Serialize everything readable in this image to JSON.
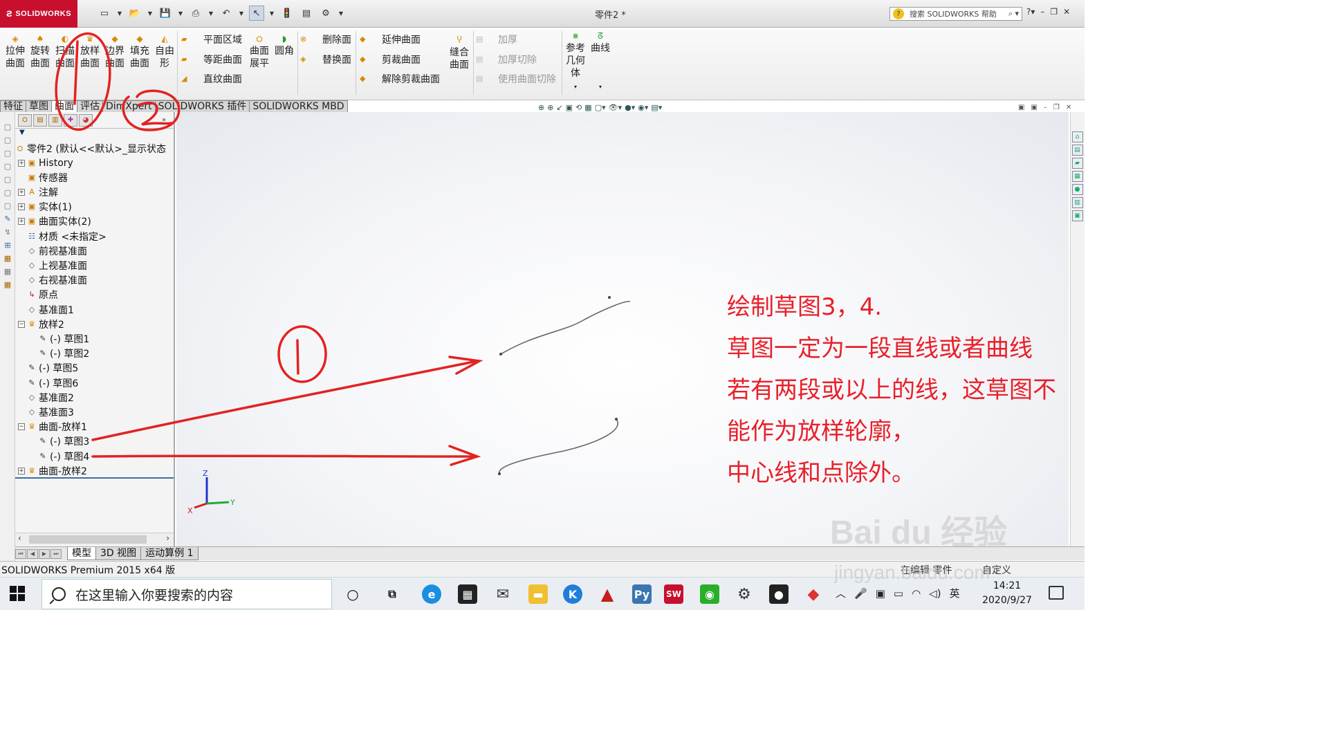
{
  "app": {
    "brand": "SOLIDWORKS",
    "doc_title": "零件2 *",
    "search_placeholder": "搜索 SOLIDWORKS 帮助",
    "help_glyph": "?"
  },
  "ribbon": {
    "big_buttons": [
      {
        "line1": "拉伸",
        "line2": "曲面",
        "icon": "extrude-surface-icon"
      },
      {
        "line1": "旋转",
        "line2": "曲面",
        "icon": "revolve-surface-icon"
      },
      {
        "line1": "扫描",
        "line2": "曲面",
        "icon": "sweep-surface-icon"
      },
      {
        "line1": "放样",
        "line2": "曲面",
        "icon": "loft-surface-icon"
      },
      {
        "line1": "边界",
        "line2": "曲面",
        "icon": "boundary-surface-icon"
      },
      {
        "line1": "填充",
        "line2": "曲面",
        "icon": "fill-surface-icon"
      },
      {
        "line1": "自由",
        "line2": "形",
        "icon": "freeform-icon"
      }
    ],
    "group2": [
      "平面区域",
      "等距曲面",
      "直纹曲面"
    ],
    "flatten": {
      "line1": "曲面",
      "line2": "展平"
    },
    "fillet": {
      "line1": "圆角",
      "line2": ""
    },
    "group3": [
      "删除面",
      "替换面"
    ],
    "group4": [
      "延伸曲面",
      "剪裁曲面",
      "解除剪裁曲面"
    ],
    "knit": {
      "line1": "缝合",
      "line2": "曲面"
    },
    "group5": [
      "加厚",
      "加厚切除",
      "使用曲面切除"
    ],
    "ref_geom": {
      "line1": "参考",
      "line2": "几何",
      "line3": "体"
    },
    "curves": {
      "line1": "曲线"
    }
  },
  "cm_tabs": [
    "特征",
    "草图",
    "曲面",
    "评估",
    "DimXpert",
    "SOLIDWORKS 插件",
    "SOLIDWORKS MBD"
  ],
  "cm_active": 2,
  "tree": {
    "root": "零件2 (默认<<默认>_显示状态",
    "items": [
      {
        "label": "History",
        "exp": "+"
      },
      {
        "label": "传感器",
        "exp": ""
      },
      {
        "label": "注解",
        "exp": "+"
      },
      {
        "label": "实体(1)",
        "exp": "+"
      },
      {
        "label": "曲面实体(2)",
        "exp": "+"
      },
      {
        "label": "材质 <未指定>",
        "exp": ""
      },
      {
        "label": "前视基准面",
        "exp": ""
      },
      {
        "label": "上视基准面",
        "exp": ""
      },
      {
        "label": "右视基准面",
        "exp": ""
      },
      {
        "label": "原点",
        "exp": ""
      },
      {
        "label": "基准面1",
        "exp": ""
      },
      {
        "label": "放样2",
        "exp": "−"
      },
      {
        "label": "(-) 草图1",
        "exp": ""
      },
      {
        "label": "(-) 草图2",
        "exp": ""
      },
      {
        "label": "(-) 草图5",
        "exp": ""
      },
      {
        "label": "(-) 草图6",
        "exp": ""
      },
      {
        "label": "基准面2",
        "exp": ""
      },
      {
        "label": "基准面3",
        "exp": ""
      },
      {
        "label": "曲面-放样1",
        "exp": "−"
      },
      {
        "label": "(-) 草图3",
        "exp": ""
      },
      {
        "label": "(-) 草图4",
        "exp": ""
      },
      {
        "label": "曲面-放样2",
        "exp": "+"
      }
    ]
  },
  "annotation": {
    "lines": [
      "绘制草图3，4.",
      "草图一定为一段直线或者曲线",
      "若有两段或以上的线，这草图不",
      "能作为放样轮廓，",
      "中心线和点除外。"
    ],
    "color": "#e8202a",
    "hand_marks": [
      "①",
      "①",
      "②"
    ]
  },
  "triad": {
    "x": "X",
    "y": "Y",
    "z": "Z"
  },
  "bottom_tabs": [
    "模型",
    "3D 视图",
    "运动算例 1"
  ],
  "bottom_active": 0,
  "status": {
    "left": "SOLIDWORKS Premium 2015 x64 版",
    "mid": "在编辑 零件",
    "right": "自定义"
  },
  "taskbar": {
    "search_placeholder": "在这里输入你要搜索的内容",
    "ime": "英",
    "time": "14:21",
    "date": "2020/9/27"
  },
  "watermark": {
    "brand": "Bai du 经验",
    "url": "jingyan.baidu.com"
  }
}
